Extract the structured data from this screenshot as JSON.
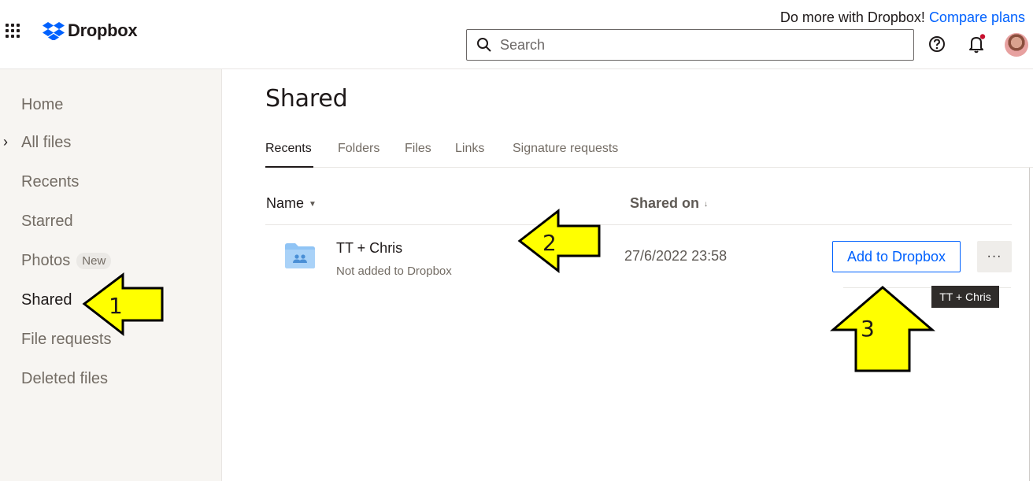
{
  "header": {
    "logo_text": "Dropbox",
    "promo_text": "Do more with Dropbox!",
    "promo_link": "Compare plans",
    "search_placeholder": "Search"
  },
  "sidebar": {
    "items": [
      {
        "label": "Home"
      },
      {
        "label": "All files"
      },
      {
        "label": "Recents"
      },
      {
        "label": "Starred"
      },
      {
        "label": "Photos",
        "badge": "New"
      },
      {
        "label": "Shared",
        "active": true
      },
      {
        "label": "File requests"
      },
      {
        "label": "Deleted files"
      }
    ]
  },
  "main": {
    "title": "Shared",
    "tabs": [
      {
        "label": "Recents",
        "active": true
      },
      {
        "label": "Folders"
      },
      {
        "label": "Files"
      },
      {
        "label": "Links"
      },
      {
        "label": "Signature requests"
      }
    ],
    "table": {
      "columns": {
        "name": "Name",
        "shared_on": "Shared on"
      },
      "rows": [
        {
          "name": "TT + Chris",
          "subtitle": "Not added to Dropbox",
          "shared_on": "27/6/2022 23:58",
          "action_label": "Add to Dropbox",
          "more_label": "···"
        }
      ]
    },
    "tooltip": "TT + Chris"
  },
  "annotations": {
    "arrow_1": "1",
    "arrow_2": "2",
    "arrow_3": "3",
    "arrow_color": "#ffff00"
  },
  "colors": {
    "accent": "#0061fe",
    "sidebar_bg": "#f7f5f2",
    "notification_dot": "#c8102e"
  }
}
